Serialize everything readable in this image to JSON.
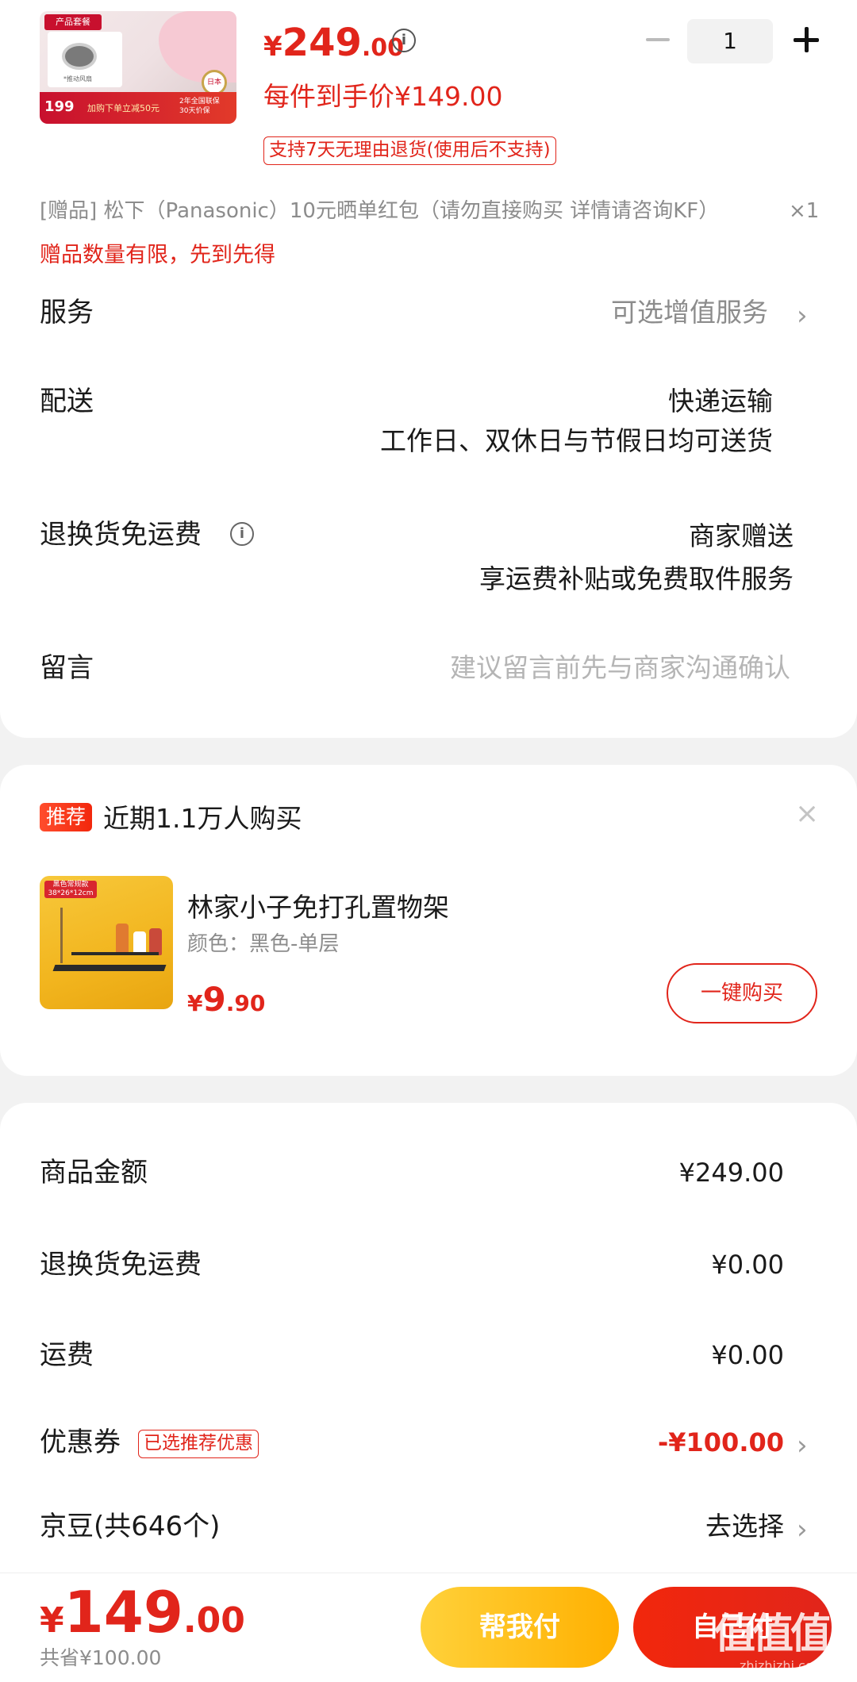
{
  "product": {
    "thumb_tag": "产品套餐",
    "thumb_device_caption": "*推动风扇",
    "thumb_price": "199",
    "thumb_promo": "加购下单立减50元",
    "thumb_note": "2年全国联保 30天价保",
    "thumb_badge": "日本精工",
    "price_yen": "¥",
    "price_int": "249",
    "price_dec": ".00",
    "per_item_price": "每件到手价¥149.00",
    "quantity": "1",
    "return_policy": "支持7天无理由退货(使用后不支持)"
  },
  "gift": {
    "line": "[赠品]  松下（Panasonic）10元晒单红包（请勿直接购买 详情请咨询KF）",
    "qty": "×1",
    "note": "赠品数量有限，先到先得"
  },
  "service": {
    "label": "服务",
    "value": "可选增值服务"
  },
  "delivery": {
    "label": "配送",
    "value1": "快递运输",
    "value2": "工作日、双休日与节假日均可送货"
  },
  "return_shipping": {
    "label": "退换货免运费",
    "value1": "商家赠送",
    "value2": "享运费补贴或免费取件服务"
  },
  "message": {
    "label": "留言",
    "placeholder": "建议留言前先与商家沟通确认"
  },
  "recommend": {
    "tag": "推荐",
    "title": "近期1.1万人购买",
    "close": "×",
    "thumb_label": "黑色常规款 38*26*12cm",
    "name": "林家小子免打孔置物架",
    "spec": "颜色：黑色-单层",
    "price_yen": "¥",
    "price_int": "9",
    "price_dec": ".90",
    "buy_label": "一键购买"
  },
  "summary": {
    "goods_label": "商品金额",
    "goods_value": "¥249.00",
    "return_label": "退换货免运费",
    "return_value": "¥0.00",
    "freight_label": "运费",
    "freight_value": "¥0.00",
    "coupon_label": "优惠券",
    "coupon_tag": "已选推荐优惠",
    "coupon_value": "-¥100.00",
    "jd_label": "京豆(共646个)",
    "jd_value": "去选择"
  },
  "bottom": {
    "total_yen": "¥",
    "total_int": "149",
    "total_dec": ".00",
    "saved": "共省¥100.00",
    "help_pay": "帮我付",
    "self_pay": "自己付"
  },
  "watermark": {
    "logo": "值值值",
    "text": "zhizhizhi.com"
  },
  "colors": {
    "accent": "#e1251b",
    "help_button": "#ffc21a",
    "rec_tag": "#f2270c"
  },
  "icons": [
    "info-icon",
    "minus-icon",
    "plus-icon",
    "chevron-right-icon",
    "close-icon"
  ]
}
